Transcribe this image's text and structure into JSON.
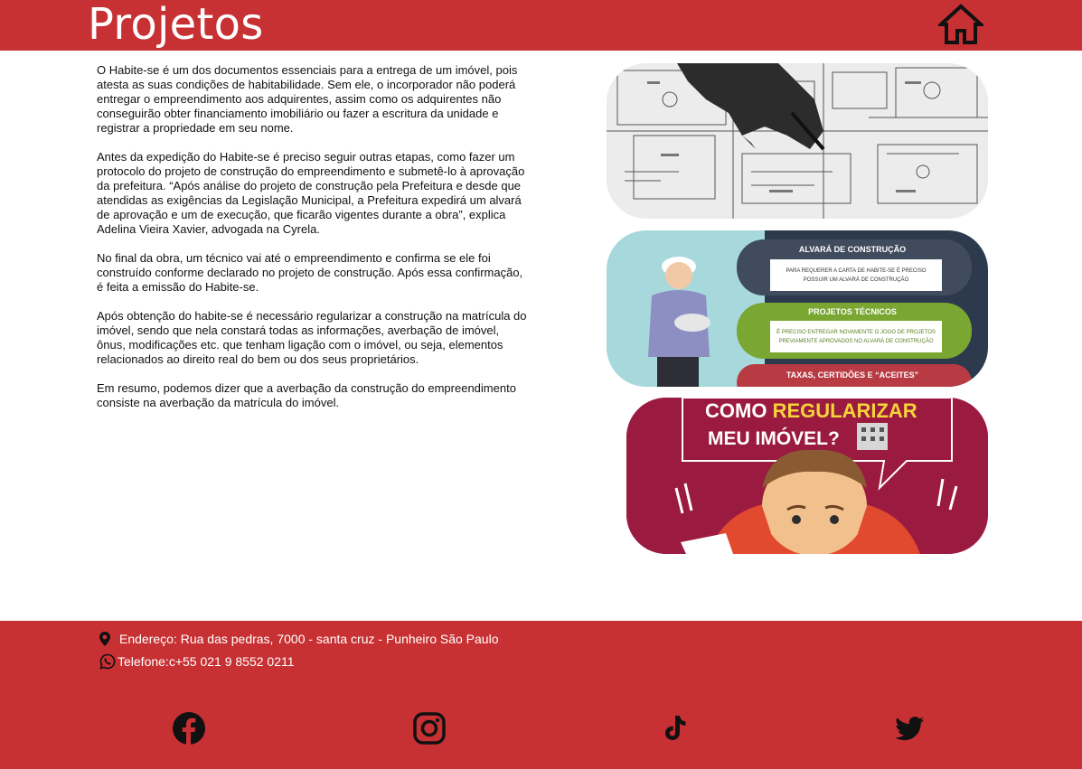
{
  "header": {
    "title": "Projetos",
    "home_icon": "home-icon"
  },
  "content": {
    "paragraphs": [
      "O Habite-se é um dos documentos essenciais para a entrega de um imóvel, pois atesta as suas condições de habitabilidade. Sem ele, o incorporador não poderá entregar o empreendimento aos adquirentes, assim como os adquirentes não conseguirão obter financiamento imobiliário ou fazer a escritura da unidade e registrar a propriedade em seu nome.",
      "Antes da expedição do Habite-se é preciso seguir outras etapas, como fazer um protocolo do projeto de construção do empreendimento e submetê-lo à aprovação da prefeitura. “Após análise do projeto de construção pela Prefeitura e desde que atendidas as exigências da Legislação Municipal, a Prefeitura expedirá um alvará de aprovação e um de execução, que ficarão vigentes durante a obra”, explica Adelina Vieira Xavier, advogada na Cyrela.",
      "No final da obra, um técnico vai até o empreendimento e confirma se ele foi construído conforme declarado no projeto de construção. Após essa confirmação, é feita a emissão do Habite-se.",
      "Após obtenção do habite-se é necessário regularizar a construção na matrícula do imóvel, sendo que nela constará todas as informações, averbação de imóvel, ônus, modificações etc. que tenham ligação com o imóvel, ou seja, elementos relacionados ao direito real do bem ou dos seus proprietários.",
      "Em resumo, podemos dizer que a averbação da construção do empreendimento consiste na averbação da matrícula do imóvel."
    ]
  },
  "images": {
    "infographic": {
      "heading_1": "ALVARÁ DE CONSTRUÇÃO",
      "text_1a": "PARA REQUERER A CARTA DE HABITE-SE É PRECISO",
      "text_1b": "POSSUIR UM ALVARÁ DE CONSTRUÇÃO",
      "heading_2": "PROJETOS TÉCNICOS",
      "text_2a": "É PRECISO ENTREGAR NOVAMENTE O JOGO DE PROJETOS",
      "text_2b": "PREVIAMENTE APROVADOS NO ALVARÁ DE CONSTRUÇÃO",
      "heading_3": "TAXAS, CERTIDÕES E “ACEITES”"
    },
    "regularizar": {
      "line1_a": "COMO ",
      "line1_b": "REGULARIZAR",
      "line2": "MEU IMÓVEL?"
    }
  },
  "footer": {
    "address": "Endereço: Rua das pedras, 7000 - santa cruz - Punheiro São Paulo",
    "phone": "Telefone:c+55 021 9 8552 0211",
    "location_icon": "location-pin-icon",
    "whatsapp_icon": "whatsapp-icon",
    "social": [
      "facebook-icon",
      "instagram-icon",
      "tiktok-icon",
      "twitter-icon"
    ]
  },
  "colors": {
    "brand_red": "#c83133",
    "text": "#111111",
    "white": "#ffffff"
  }
}
